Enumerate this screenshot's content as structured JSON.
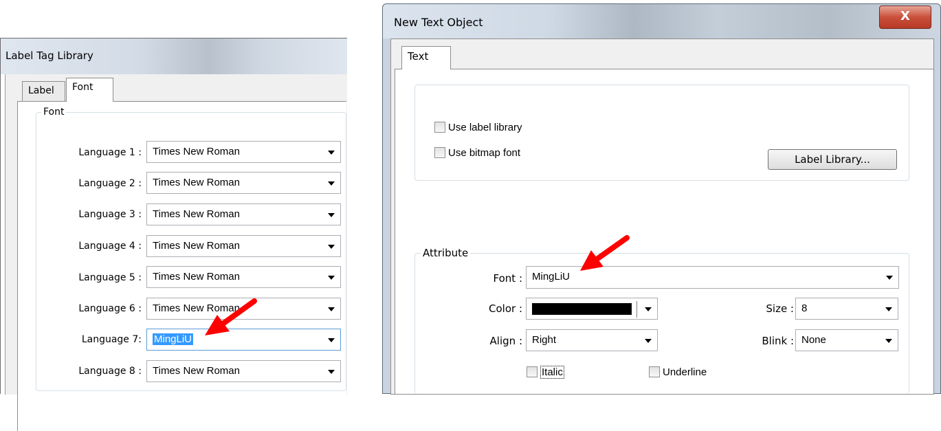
{
  "left_window": {
    "title": "Label Tag Library",
    "tabs": [
      "Label",
      "Font"
    ],
    "active_tab": "Font",
    "group_title": "Font",
    "languages": [
      {
        "label": "Language 1 :",
        "value": "Times New Roman"
      },
      {
        "label": "Language 2 :",
        "value": "Times New Roman"
      },
      {
        "label": "Language 3 :",
        "value": "Times New Roman"
      },
      {
        "label": "Language 4 :",
        "value": "Times New Roman"
      },
      {
        "label": "Language 5 :",
        "value": "Times New Roman"
      },
      {
        "label": "Language 6 :",
        "value": "Times New Roman"
      },
      {
        "label": "Language 7:",
        "value": "MingLiU"
      },
      {
        "label": "Language 8 :",
        "value": "Times New Roman"
      }
    ]
  },
  "right_window": {
    "title": "New  Text Object",
    "close_label": "X",
    "tab": "Text",
    "use_label_library": "Use label library",
    "use_bitmap_font": "Use bitmap font",
    "label_library_button": "Label Library...",
    "attribute_group": "Attribute",
    "font_label": "Font :",
    "font_value": "MingLiU",
    "color_label": "Color :",
    "color_value": "#000000",
    "size_label": "Size :",
    "size_value": "8",
    "align_label": "Align :",
    "align_value": "Right",
    "blink_label": "Blink :",
    "blink_value": "None",
    "italic_label": "Italic",
    "underline_label": "Underline"
  },
  "annotation": {
    "arrow_color": "#ff0000"
  }
}
